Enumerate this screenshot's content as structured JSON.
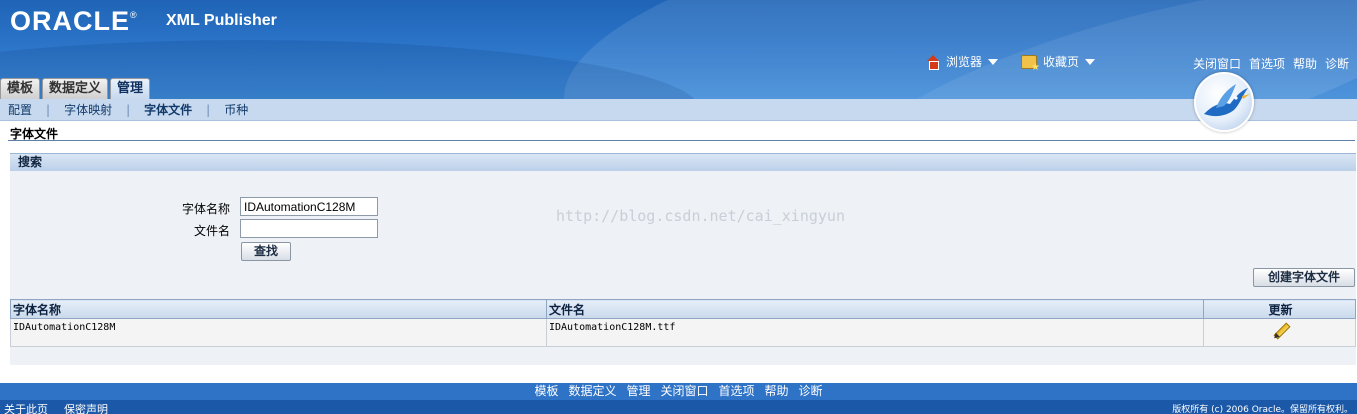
{
  "header": {
    "logo": "ORACLE",
    "logo_reg": "®",
    "product": "XML Publisher",
    "menus": {
      "browser": "浏览器",
      "favorites": "收藏页"
    },
    "links": [
      "关闭窗口",
      "首选项",
      "帮助",
      "诊断"
    ]
  },
  "tabs": [
    {
      "label": "模板",
      "active": false
    },
    {
      "label": "数据定义",
      "active": false
    },
    {
      "label": "管理",
      "active": true
    }
  ],
  "subnav": [
    {
      "label": "配置",
      "current": false
    },
    {
      "label": "字体映射",
      "current": false
    },
    {
      "label": "字体文件",
      "current": true
    },
    {
      "label": "币种",
      "current": false
    }
  ],
  "page_title": "字体文件",
  "search": {
    "title": "搜索",
    "font_name_label": "字体名称",
    "font_name_value": "IDAutomationC128M",
    "file_name_label": "文件名",
    "file_name_value": "",
    "find_button": "查找"
  },
  "watermark": "http://blog.csdn.net/cai_xingyun",
  "create_button": "创建字体文件",
  "table": {
    "columns": [
      "字体名称",
      "文件名",
      "更新"
    ],
    "rows": [
      {
        "font_name": "IDAutomationC128M",
        "file_name": "IDAutomationC128M.ttf"
      }
    ]
  },
  "footer": {
    "links": [
      "模板",
      "数据定义",
      "管理",
      "关闭窗口",
      "首选项",
      "帮助",
      "诊断"
    ],
    "bottom_links": [
      "关于此页",
      "保密声明"
    ],
    "copyright": "版权所有 (c) 2006 Oracle。保留所有权利。"
  }
}
